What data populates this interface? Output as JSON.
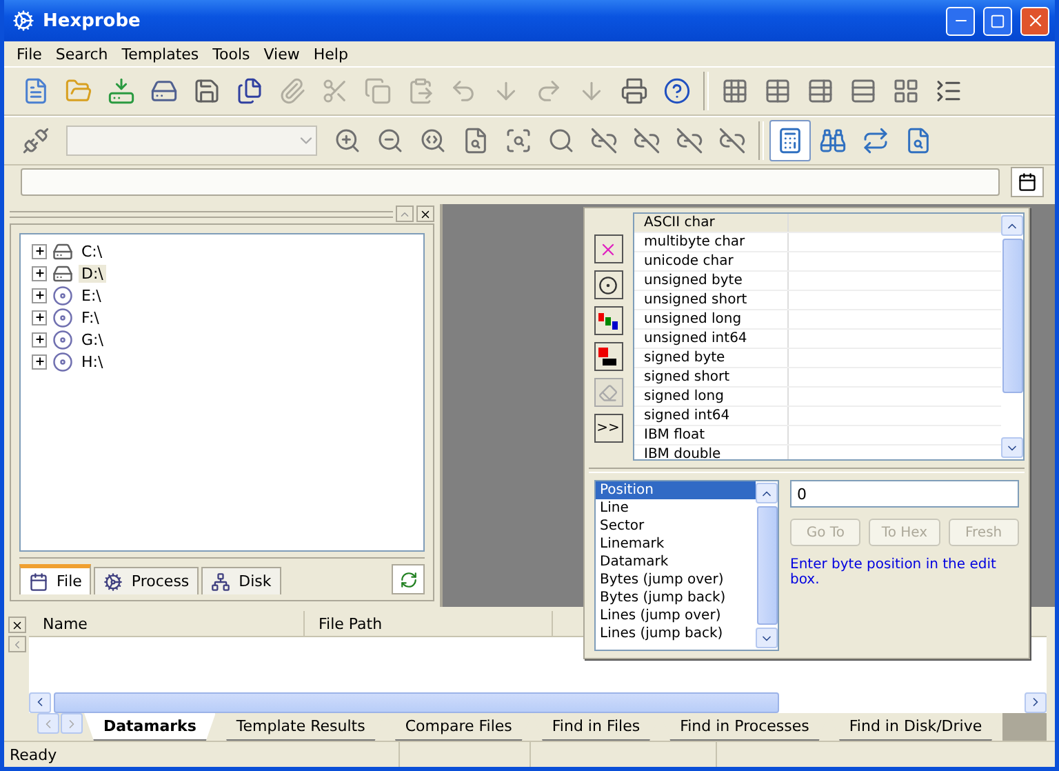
{
  "window": {
    "title": "Hexprobe"
  },
  "menu": [
    "File",
    "Search",
    "Templates",
    "Tools",
    "View",
    "Help"
  ],
  "toolbar_1": [
    {
      "disabled": false
    },
    {
      "disabled": false
    },
    {
      "disabled": false
    },
    {
      "disabled": false
    },
    {
      "disabled": false
    },
    {
      "disabled": false
    },
    {
      "disabled": true
    },
    {
      "disabled": true
    },
    {
      "disabled": true
    },
    {
      "disabled": true
    },
    {
      "disabled": true
    },
    {
      "disabled": true
    },
    {
      "disabled": true
    },
    {
      "disabled": true
    },
    {
      "disabled": false
    },
    {
      "disabled": false
    },
    {
      "disabled": false
    },
    {
      "disabled": false
    },
    {
      "disabled": false
    },
    {
      "disabled": false
    },
    {
      "disabled": false
    },
    {
      "disabled": false
    }
  ],
  "toolbar_2": [
    {
      "pressed": false
    },
    {
      "pressed": false
    },
    {
      "pressed": false
    },
    {
      "pressed": false
    },
    {
      "pressed": false
    },
    {
      "pressed": false
    },
    {
      "pressed": false
    },
    {
      "pressed": false
    },
    {
      "pressed": false
    },
    {
      "pressed": false
    },
    {
      "pressed": false
    },
    {
      "pressed": true
    },
    {
      "pressed": false
    },
    {
      "pressed": false
    },
    {
      "pressed": false
    }
  ],
  "tree": [
    {
      "label": "C:\\",
      "kind": "hard-disk",
      "selected": false
    },
    {
      "label": "D:\\",
      "kind": "hard-disk",
      "selected": true
    },
    {
      "label": "E:\\",
      "kind": "cd-drive",
      "selected": false
    },
    {
      "label": "F:\\",
      "kind": "cd-drive",
      "selected": false
    },
    {
      "label": "G:\\",
      "kind": "cd-drive",
      "selected": false
    },
    {
      "label": "H:\\",
      "kind": "cd-drive",
      "selected": false
    }
  ],
  "panel_tabs": [
    {
      "label": "File",
      "selected": true
    },
    {
      "label": "Process",
      "selected": false
    },
    {
      "label": "Disk",
      "selected": false
    }
  ],
  "inspector": {
    "rows": [
      {
        "label": "ASCII char",
        "selected": true
      },
      {
        "label": "multibyte char",
        "selected": false
      },
      {
        "label": "unicode char",
        "selected": false
      },
      {
        "label": "unsigned byte",
        "selected": false
      },
      {
        "label": "unsigned short",
        "selected": false
      },
      {
        "label": "unsigned long",
        "selected": false
      },
      {
        "label": "unsigned int64",
        "selected": false
      },
      {
        "label": "signed byte",
        "selected": false
      },
      {
        "label": "signed short",
        "selected": false
      },
      {
        "label": "signed long",
        "selected": false
      },
      {
        "label": "signed int64",
        "selected": false
      },
      {
        "label": "IBM float",
        "selected": false
      },
      {
        "label": "IBM double",
        "selected": false
      }
    ],
    "expand_button": ">>",
    "side_buttons": [
      {
        "disabled": false
      },
      {
        "disabled": false
      },
      {
        "disabled": false
      },
      {
        "disabled": false
      },
      {
        "disabled": true
      }
    ]
  },
  "goto": {
    "options": [
      {
        "label": "Position",
        "selected": true
      },
      {
        "label": "Line",
        "selected": false
      },
      {
        "label": "Sector",
        "selected": false
      },
      {
        "label": "Linemark",
        "selected": false
      },
      {
        "label": "Datamark",
        "selected": false
      },
      {
        "label": "Bytes (jump over)",
        "selected": false
      },
      {
        "label": "Bytes (jump back)",
        "selected": false
      },
      {
        "label": "Lines (jump over)",
        "selected": false
      },
      {
        "label": "Lines (jump back)",
        "selected": false
      }
    ],
    "value": "0",
    "buttons": [
      {
        "label": "Go To",
        "disabled": true
      },
      {
        "label": "To Hex",
        "disabled": true
      },
      {
        "label": "Fresh",
        "disabled": true
      }
    ],
    "hint": "Enter byte position in the edit box."
  },
  "results": {
    "columns": [
      "Name",
      "File Path"
    ],
    "tabs": [
      {
        "label": "Datamarks",
        "selected": true
      },
      {
        "label": "Template Results",
        "selected": false
      },
      {
        "label": "Compare Files",
        "selected": false
      },
      {
        "label": "Find in Files",
        "selected": false
      },
      {
        "label": "Find in Processes",
        "selected": false
      },
      {
        "label": "Find in Disk/Drive",
        "selected": false
      }
    ]
  },
  "status_bar": {
    "text": "Ready"
  }
}
